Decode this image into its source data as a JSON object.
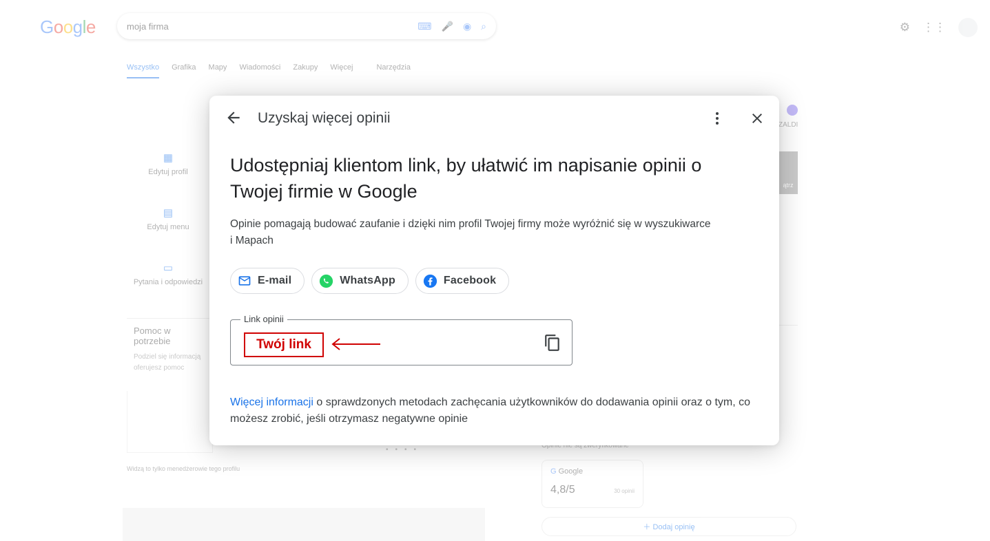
{
  "background": {
    "logo": [
      "G",
      "o",
      "o",
      "g",
      "l",
      "e"
    ],
    "search_query": "moja firma",
    "tabs": [
      "Wszystko",
      "Grafika",
      "Mapy",
      "Wiadomości",
      "Zakupy",
      "Więcej",
      "Narzędzia"
    ],
    "left_actions": [
      "Edytuj profil",
      "Edytuj menu",
      "Pytania i odpowiedzi"
    ],
    "help_title": "Pomoc w potrzebie",
    "help_text": "Podziel się informacją oferujesz pomoc",
    "managers_note": "Widzą to tylko menedżerowie tego profilu",
    "reviews_not_verified": "Opinie nie są zweryfikowane",
    "review_source": "Google",
    "rating": "4,8/5",
    "review_count": "30 opinii",
    "add_review": "Dodaj opinię",
    "side_label_1": "ZALDI",
    "side_label_2": "ątrz"
  },
  "modal": {
    "title": "Uzyskaj więcej opinii",
    "heading": "Udostępniaj klientom link, by ułatwić im napisanie opinii o Twojej firmie w Google",
    "description": "Opinie pomagają budować zaufanie i dzięki nim profil Twojej firmy może wyróżnić się w wyszukiwarce i Mapach",
    "share": {
      "email": "E-mail",
      "whatsapp": "WhatsApp",
      "facebook": "Facebook"
    },
    "link_label": "Link opinii",
    "link_placeholder_annotation": "Twój link",
    "more_info_link": "Więcej informacji",
    "footer_text": " o sprawdzonych metodach zachęcania użytkowników do dodawania opinii oraz o tym, co możesz zrobić, jeśli otrzymasz negatywne opinie"
  },
  "colors": {
    "accent": "#1a73e8",
    "annotation_red": "#d00000",
    "whatsapp_green": "#25d366",
    "facebook_blue": "#1877f2"
  }
}
